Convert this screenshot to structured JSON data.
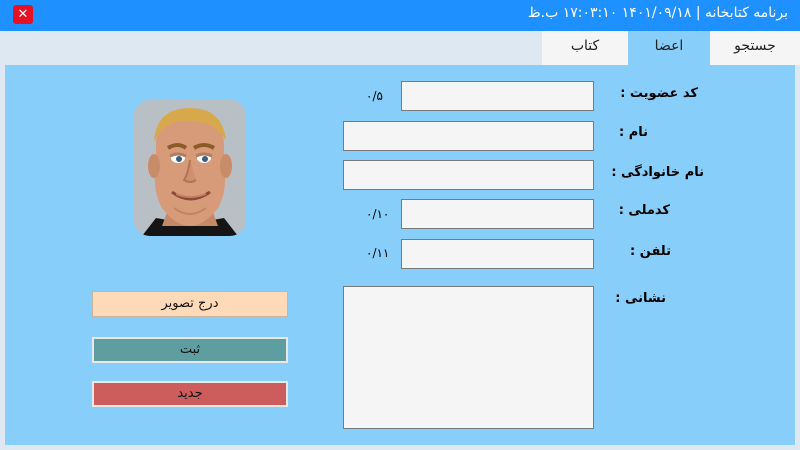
{
  "window": {
    "title": "برنامه کتابخانه  |  ۱۴۰۱/۰۹/۱۸  ۱۷:۰۳:۱۰ ب.ظ",
    "close_symbol": "✕",
    "titlebar_color": "#1e90ff"
  },
  "tabs": [
    {
      "label": "جستجو",
      "active": false
    },
    {
      "label": "اعضا",
      "active": true
    },
    {
      "label": "کتاب",
      "active": false
    }
  ],
  "form": {
    "member_code_label": "کد عضویت :",
    "member_code_counter": "۰/۵",
    "name_label": "نام :",
    "family_label": "نام خانوادگی :",
    "national_code_label": "کدملی :",
    "national_code_counter": "۰/۱۰",
    "phone_label": "تلفن :",
    "phone_counter": "۰/۱۱",
    "address_label": "نشانی :"
  },
  "buttons": {
    "insert_image": "درج تصویر",
    "save": "ثبت",
    "new": "جدید"
  },
  "colors": {
    "panel": "#87cefa",
    "insert_button": "#ffdab9",
    "save_button": "#5f9ea0",
    "new_button": "#cd5c5c"
  }
}
